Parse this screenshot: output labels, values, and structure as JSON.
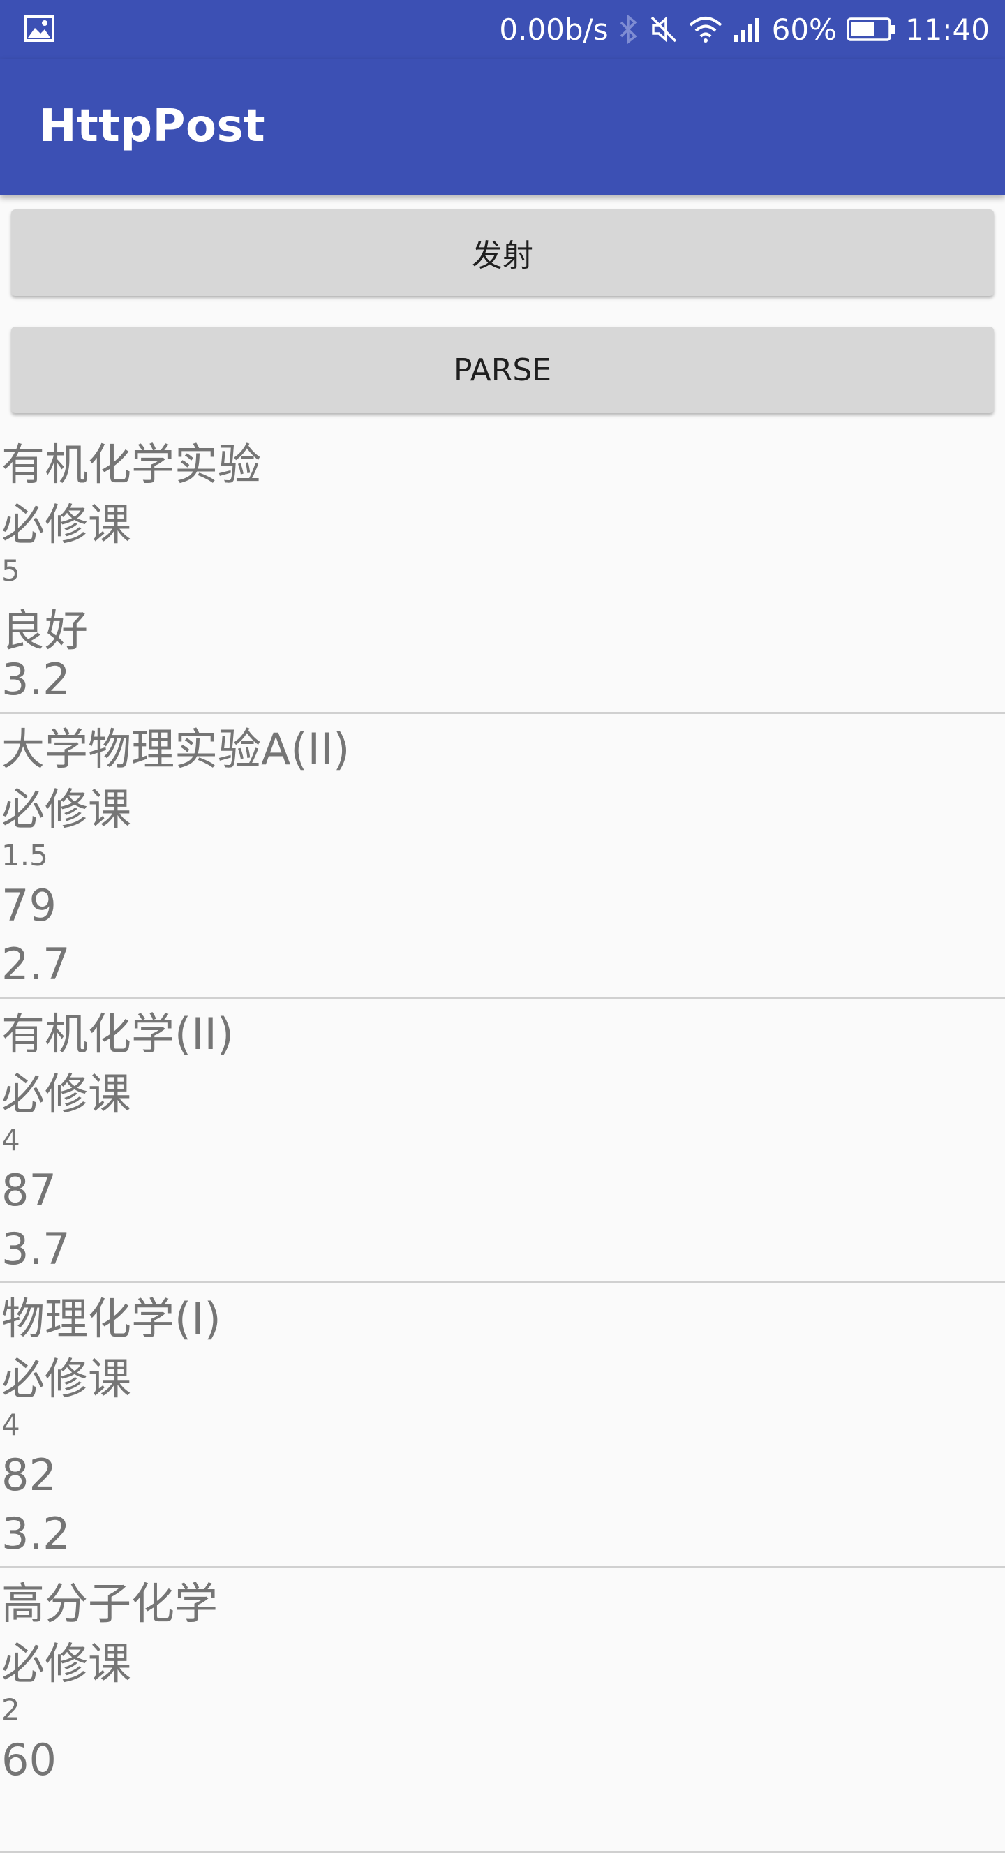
{
  "status_bar": {
    "speed": "0.00b/s",
    "battery": "60%",
    "time": "11:40"
  },
  "app_bar": {
    "title": "HttpPost"
  },
  "buttons": {
    "fire": "发射",
    "parse": "PARSE"
  },
  "courses": [
    {
      "name": "有机化学实验",
      "type": "必修课",
      "credit": "5",
      "score": "良好",
      "gpa": "3.2"
    },
    {
      "name": "大学物理实验A(II)",
      "type": "必修课",
      "credit": "1.5",
      "score": "79",
      "gpa": "2.7"
    },
    {
      "name": "有机化学(II)",
      "type": "必修课",
      "credit": "4",
      "score": "87",
      "gpa": "3.7"
    },
    {
      "name": "物理化学(I)",
      "type": "必修课",
      "credit": "4",
      "score": "82",
      "gpa": "3.2"
    },
    {
      "name": "高分子化学",
      "type": "必修课",
      "credit": "2",
      "score": "60",
      "gpa": ""
    }
  ],
  "colors": {
    "primary": "#3c50b4",
    "button": "#d7d7d7",
    "text": "#757575",
    "background": "#fafafa"
  }
}
